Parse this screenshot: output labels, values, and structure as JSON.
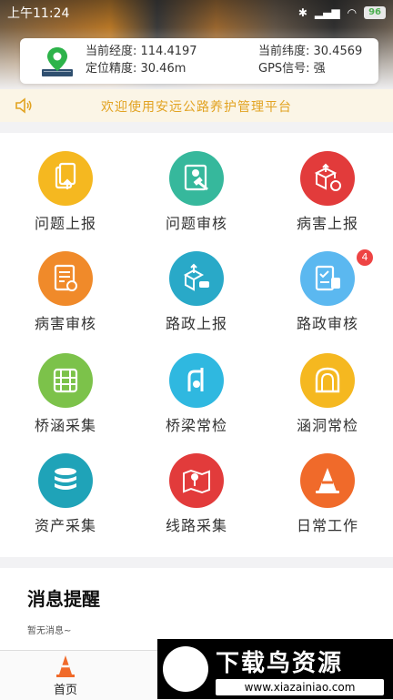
{
  "status_bar": {
    "time": "上午11:24",
    "icons": [
      "bluetooth-icon",
      "signal-icon",
      "wifi-icon"
    ],
    "battery": "96"
  },
  "gps": {
    "longitude_label": "当前经度: 114.4197",
    "latitude_label": "当前纬度: 30.4569",
    "accuracy_label": "定位精度: 30.46m",
    "signal_label": "GPS信号: 强"
  },
  "notice": {
    "text": "欢迎使用安远公路养护管理平台",
    "color": "#e2a322"
  },
  "menu": {
    "items": [
      {
        "label": "问题上报",
        "color": "#f5b820",
        "icon": "report-upload-icon"
      },
      {
        "label": "问题审核",
        "color": "#36b89c",
        "icon": "review-hammer-icon"
      },
      {
        "label": "病害上报",
        "color": "#e23b3b",
        "icon": "disease-upload-icon"
      },
      {
        "label": "病害审核",
        "color": "#f08a2a",
        "icon": "disease-review-icon"
      },
      {
        "label": "路政上报",
        "color": "#29a9c8",
        "icon": "road-admin-upload-icon"
      },
      {
        "label": "路政审核",
        "color": "#5bb8f0",
        "icon": "road-admin-review-icon",
        "badge": "4"
      },
      {
        "label": "桥涵采集",
        "color": "#7cc24a",
        "icon": "culvert-collect-icon"
      },
      {
        "label": "桥梁常检",
        "color": "#2fb8e0",
        "icon": "bridge-inspect-icon"
      },
      {
        "label": "涵洞常检",
        "color": "#f5b820",
        "icon": "tunnel-inspect-icon"
      },
      {
        "label": "资产采集",
        "color": "#1fa3b8",
        "icon": "database-icon"
      },
      {
        "label": "线路采集",
        "color": "#e23b3b",
        "icon": "map-icon"
      },
      {
        "label": "日常工作",
        "color": "#f06a2a",
        "icon": "traffic-cone-icon"
      }
    ]
  },
  "messages": {
    "title": "消息提醒",
    "empty": "暂无消息~"
  },
  "tabbar": {
    "home_label": "首页"
  },
  "watermark": {
    "title": "下载鸟资源",
    "url": "www.xiazainiao.com"
  }
}
